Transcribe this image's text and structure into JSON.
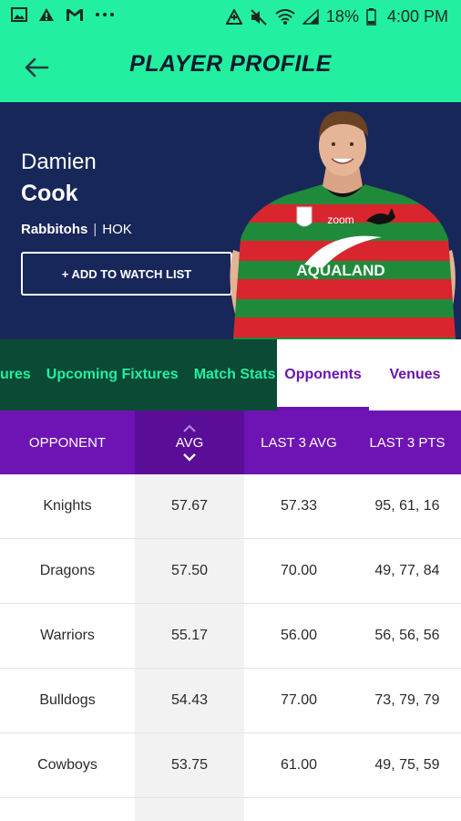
{
  "status_bar": {
    "battery_pct": "18%",
    "time": "4:00 PM",
    "icons": [
      "image-icon",
      "alert-icon",
      "gmail-icon",
      "more-dots-icon",
      "data-saver-icon",
      "mute-icon",
      "wifi-icon",
      "signal-icon",
      "battery-icon"
    ]
  },
  "header": {
    "title": "PLAYER PROFILE",
    "back_icon": "arrow-left-icon"
  },
  "player": {
    "first_name": "Damien",
    "last_name": "Cook",
    "team": "Rabbitohs",
    "position": "HOK",
    "separator": "|",
    "jersey_sponsor": "AQUALAND",
    "jersey_logo_text": "zoom",
    "watch_button": "+ ADD TO WATCH LIST"
  },
  "tabs": {
    "items": [
      "ures",
      "Upcoming Fixtures",
      "Match Stats",
      "Opponents",
      "Venues"
    ],
    "active": "Opponents"
  },
  "table": {
    "columns": [
      "OPPONENT",
      "AVG",
      "LAST 3 AVG",
      "LAST 3 PTS"
    ],
    "sorted_column": "AVG",
    "rows": [
      [
        "Knights",
        "57.67",
        "57.33",
        "95, 61, 16"
      ],
      [
        "Dragons",
        "57.50",
        "70.00",
        "49, 77, 84"
      ],
      [
        "Warriors",
        "55.17",
        "56.00",
        "56, 56, 56"
      ],
      [
        "Bulldogs",
        "54.43",
        "77.00",
        "73, 79, 79"
      ],
      [
        "Cowboys",
        "53.75",
        "61.00",
        "49, 75, 59"
      ]
    ]
  },
  "colors": {
    "accent_green": "#22f0a0",
    "navy": "#18275a",
    "dark_green": "#0b4a35",
    "purple": "#6e14b4",
    "purple_dark": "#5a0e98"
  }
}
